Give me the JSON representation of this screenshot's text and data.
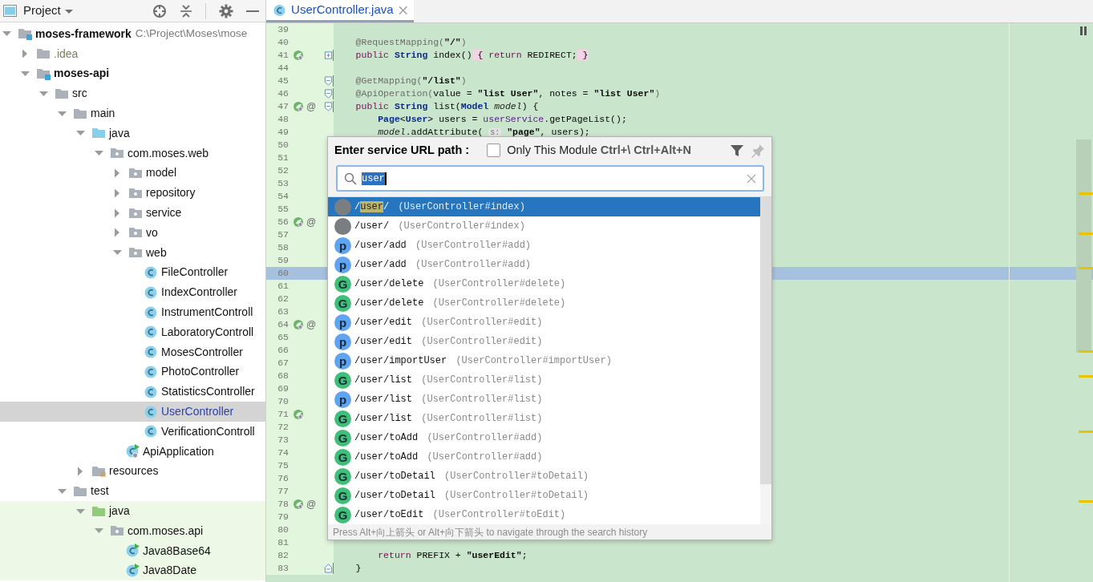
{
  "project_panel": {
    "title": "Project"
  },
  "tree": [
    {
      "name": "moses-framework",
      "kind": "module",
      "path": "C:\\Project\\Moses\\mose",
      "expanded": true,
      "selected": false,
      "children": [
        {
          "name": ".idea",
          "kind": "ignored-folder",
          "expanded": false,
          "selected": false
        },
        {
          "name": "moses-api",
          "kind": "module",
          "expanded": true,
          "selected": false,
          "children": [
            {
              "name": "src",
              "kind": "folder",
              "expanded": true,
              "selected": false,
              "children": [
                {
                  "name": "main",
                  "kind": "folder",
                  "expanded": true,
                  "selected": false,
                  "children": [
                    {
                      "name": "java",
                      "kind": "source-folder",
                      "expanded": true,
                      "selected": false,
                      "children": [
                        {
                          "name": "com.moses.web",
                          "kind": "package",
                          "expanded": true,
                          "selected": false,
                          "children": [
                            {
                              "name": "model",
                              "kind": "package",
                              "expanded": false,
                              "selected": false
                            },
                            {
                              "name": "repository",
                              "kind": "package",
                              "expanded": false,
                              "selected": false
                            },
                            {
                              "name": "service",
                              "kind": "package",
                              "expanded": false,
                              "selected": false
                            },
                            {
                              "name": "vo",
                              "kind": "package",
                              "expanded": false,
                              "selected": false
                            },
                            {
                              "name": "web",
                              "kind": "package",
                              "expanded": true,
                              "selected": false,
                              "children": [
                                {
                                  "name": "FileController",
                                  "kind": "class",
                                  "selected": false
                                },
                                {
                                  "name": "IndexController",
                                  "kind": "class",
                                  "selected": false
                                },
                                {
                                  "name": "InstrumentControll",
                                  "kind": "class",
                                  "selected": false
                                },
                                {
                                  "name": "LaboratoryControll",
                                  "kind": "class",
                                  "selected": false
                                },
                                {
                                  "name": "MosesController",
                                  "kind": "class",
                                  "selected": false
                                },
                                {
                                  "name": "PhotoController",
                                  "kind": "class",
                                  "selected": false
                                },
                                {
                                  "name": "StatisticsController",
                                  "kind": "class",
                                  "selected": false
                                },
                                {
                                  "name": "UserController",
                                  "kind": "class",
                                  "selected": true
                                },
                                {
                                  "name": "VerificationControll",
                                  "kind": "class",
                                  "selected": false
                                }
                              ]
                            },
                            {
                              "name": "ApiApplication",
                              "kind": "app-class",
                              "selected": false
                            }
                          ]
                        }
                      ]
                    },
                    {
                      "name": "resources",
                      "kind": "resources-folder",
                      "expanded": false,
                      "selected": false
                    }
                  ]
                },
                {
                  "name": "test",
                  "kind": "folder",
                  "expanded": true,
                  "selected": false,
                  "children": [
                    {
                      "name": "java",
                      "kind": "test-folder",
                      "expanded": true,
                      "selected": false,
                      "children": [
                        {
                          "name": "com.moses.api",
                          "kind": "package",
                          "expanded": true,
                          "selected": false,
                          "children": [
                            {
                              "name": "Java8Base64",
                              "kind": "test-class",
                              "selected": false
                            },
                            {
                              "name": "Java8Date",
                              "kind": "test-class",
                              "selected": false
                            }
                          ]
                        }
                      ]
                    }
                  ]
                }
              ]
            }
          ]
        }
      ]
    }
  ],
  "editor": {
    "tab": {
      "title": "UserController.java",
      "selected": true
    },
    "lines": [
      {
        "num": "39",
        "caret": false
      },
      {
        "num": "40",
        "caret": false,
        "tokens": [
          {
            "t": "    @RequestMapping(",
            "kind": "ann"
          },
          {
            "t": "\"/\"",
            "kind": "str"
          },
          {
            "t": ")",
            "kind": "ann"
          }
        ]
      },
      {
        "num": "41",
        "caret": false,
        "marks": [
          {
            "kind": "bean"
          }
        ],
        "fold": {
          "kind": "collapsed"
        },
        "tokens": [
          {
            "t": "    public",
            "kind": "kw"
          },
          {
            "t": " String",
            "kind": "type"
          },
          {
            "t": " index()",
            "kind": "plain"
          },
          {
            "t": " {",
            "kind": "folded"
          },
          {
            "t": " return",
            "kind": "kw"
          },
          {
            "t": " REDIRECT;",
            "kind": "plain"
          },
          {
            "t": " }",
            "kind": "folded"
          }
        ]
      },
      {
        "num": "44",
        "caret": false
      },
      {
        "num": "45",
        "caret": false,
        "fold": {
          "kind": "start"
        },
        "tokens": [
          {
            "t": "    @GetMapping(",
            "kind": "ann"
          },
          {
            "t": "\"/list\"",
            "kind": "str"
          },
          {
            "t": ")",
            "kind": "ann"
          }
        ]
      },
      {
        "num": "46",
        "caret": false,
        "fold": {
          "kind": "start"
        },
        "tokens": [
          {
            "t": "    @ApiOperation(",
            "kind": "ann"
          },
          {
            "t": "value = ",
            "kind": "plain"
          },
          {
            "t": "\"list User\"",
            "kind": "str"
          },
          {
            "t": ", notes = ",
            "kind": "plain"
          },
          {
            "t": "\"list User\"",
            "kind": "str"
          },
          {
            "t": ")",
            "kind": "ann"
          }
        ]
      },
      {
        "num": "47",
        "caret": false,
        "marks": [
          {
            "kind": "bean"
          }
        ],
        "gutter_text": "@",
        "fold": {
          "kind": "start"
        },
        "tokens": [
          {
            "t": "    public",
            "kind": "kw"
          },
          {
            "t": " String",
            "kind": "type"
          },
          {
            "t": " list(",
            "kind": "plain"
          },
          {
            "t": "Model",
            "kind": "type"
          },
          {
            "t": " model",
            "kind": "param"
          },
          {
            "t": ") {",
            "kind": "plain"
          }
        ]
      },
      {
        "num": "48",
        "caret": false,
        "tokens": [
          {
            "t": "        Page",
            "kind": "type"
          },
          {
            "t": "<",
            "kind": "plain"
          },
          {
            "t": "User",
            "kind": "type"
          },
          {
            "t": "> users = ",
            "kind": "plain"
          },
          {
            "t": "userService",
            "kind": "field"
          },
          {
            "t": ".getPageList();",
            "kind": "plain"
          }
        ]
      },
      {
        "num": "49",
        "caret": false,
        "tokens": [
          {
            "t": "        model",
            "kind": "param"
          },
          {
            "t": ".addAttribute( ",
            "kind": "plain"
          },
          {
            "t": "s:",
            "kind": "hint"
          },
          {
            "t": " \"page\"",
            "kind": "str"
          },
          {
            "t": ", users);",
            "kind": "plain"
          }
        ]
      },
      {
        "num": "50",
        "caret": false
      },
      {
        "num": "51",
        "caret": false
      },
      {
        "num": "52",
        "caret": false
      },
      {
        "num": "53",
        "caret": false
      },
      {
        "num": "54",
        "caret": false
      },
      {
        "num": "55",
        "caret": false
      },
      {
        "num": "56",
        "caret": false,
        "marks": [
          {
            "kind": "bean"
          }
        ],
        "gutter_text": "@"
      },
      {
        "num": "57",
        "caret": false
      },
      {
        "num": "58",
        "caret": false
      },
      {
        "num": "59",
        "caret": false
      },
      {
        "num": "60",
        "caret": true
      },
      {
        "num": "61",
        "caret": false
      },
      {
        "num": "62",
        "caret": false
      },
      {
        "num": "63",
        "caret": false
      },
      {
        "num": "64",
        "caret": false,
        "marks": [
          {
            "kind": "bean"
          }
        ],
        "gutter_text": "@"
      },
      {
        "num": "65",
        "caret": false
      },
      {
        "num": "66",
        "caret": false
      },
      {
        "num": "67",
        "caret": false
      },
      {
        "num": "68",
        "caret": false
      },
      {
        "num": "69",
        "caret": false
      },
      {
        "num": "70",
        "caret": false
      },
      {
        "num": "71",
        "caret": false,
        "marks": [
          {
            "kind": "bean"
          }
        ]
      },
      {
        "num": "72",
        "caret": false
      },
      {
        "num": "73",
        "caret": false
      },
      {
        "num": "74",
        "caret": false
      },
      {
        "num": "75",
        "caret": false
      },
      {
        "num": "76",
        "caret": false
      },
      {
        "num": "77",
        "caret": false
      },
      {
        "num": "78",
        "caret": false,
        "marks": [
          {
            "kind": "bean"
          }
        ],
        "gutter_text": "@"
      },
      {
        "num": "79",
        "caret": false
      },
      {
        "num": "80",
        "caret": false
      },
      {
        "num": "81",
        "caret": false
      },
      {
        "num": "82",
        "caret": false,
        "tokens": [
          {
            "t": "        return",
            "kind": "kw"
          },
          {
            "t": " PREFIX + ",
            "kind": "plain"
          },
          {
            "t": "\"userEdit\"",
            "kind": "str"
          },
          {
            "t": ";",
            "kind": "plain"
          }
        ]
      },
      {
        "num": "83",
        "caret": false,
        "fold": {
          "kind": "end"
        },
        "tokens": [
          {
            "t": "    }",
            "kind": "plain"
          }
        ]
      }
    ]
  },
  "popup": {
    "title": "Enter service URL path :",
    "only_this_module": {
      "label": "Only This Module",
      "checked": false,
      "shortcut": "Ctrl+\\ Ctrl+Alt+N"
    },
    "search": {
      "value": "user",
      "value_selected": true
    },
    "results": [
      {
        "kind": "any",
        "path_parts": [
          {
            "t": "/",
            "match": false
          },
          {
            "t": "user",
            "match": true
          },
          {
            "t": "/",
            "match": false
          }
        ],
        "handler": "(UserController#index)",
        "selected": true
      },
      {
        "kind": "any",
        "path": "/user/",
        "handler": "(UserController#index)",
        "selected": false
      },
      {
        "kind": "post",
        "badge": "p",
        "path": "/user/add",
        "handler": "(UserController#add)",
        "selected": false
      },
      {
        "kind": "post",
        "badge": "p",
        "path": "/user/add",
        "handler": "(UserController#add)",
        "selected": false
      },
      {
        "kind": "get",
        "badge": "G",
        "path": "/user/delete",
        "handler": "(UserController#delete)",
        "selected": false
      },
      {
        "kind": "get",
        "badge": "G",
        "path": "/user/delete",
        "handler": "(UserController#delete)",
        "selected": false
      },
      {
        "kind": "post",
        "badge": "p",
        "path": "/user/edit",
        "handler": "(UserController#edit)",
        "selected": false
      },
      {
        "kind": "post",
        "badge": "p",
        "path": "/user/edit",
        "handler": "(UserController#edit)",
        "selected": false
      },
      {
        "kind": "post",
        "badge": "p",
        "path": "/user/importUser",
        "handler": "(UserController#importUser)",
        "selected": false
      },
      {
        "kind": "get",
        "badge": "G",
        "path": "/user/list",
        "handler": "(UserController#list)",
        "selected": false
      },
      {
        "kind": "post",
        "badge": "p",
        "path": "/user/list",
        "handler": "(UserController#list)",
        "selected": false
      },
      {
        "kind": "get",
        "badge": "G",
        "path": "/user/list",
        "handler": "(UserController#list)",
        "selected": false
      },
      {
        "kind": "get",
        "badge": "G",
        "path": "/user/toAdd",
        "handler": "(UserController#add)",
        "selected": false
      },
      {
        "kind": "get",
        "badge": "G",
        "path": "/user/toAdd",
        "handler": "(UserController#add)",
        "selected": false
      },
      {
        "kind": "get",
        "badge": "G",
        "path": "/user/toDetail",
        "handler": "(UserController#toDetail)",
        "selected": false
      },
      {
        "kind": "get",
        "badge": "G",
        "path": "/user/toDetail",
        "handler": "(UserController#toDetail)",
        "selected": false
      },
      {
        "kind": "get",
        "badge": "G",
        "path": "/user/toEdit",
        "handler": "(UserController#toEdit)",
        "selected": false
      }
    ],
    "hint": "Press Alt+向上箭头 or Alt+向下箭头 to navigate through the search history"
  }
}
